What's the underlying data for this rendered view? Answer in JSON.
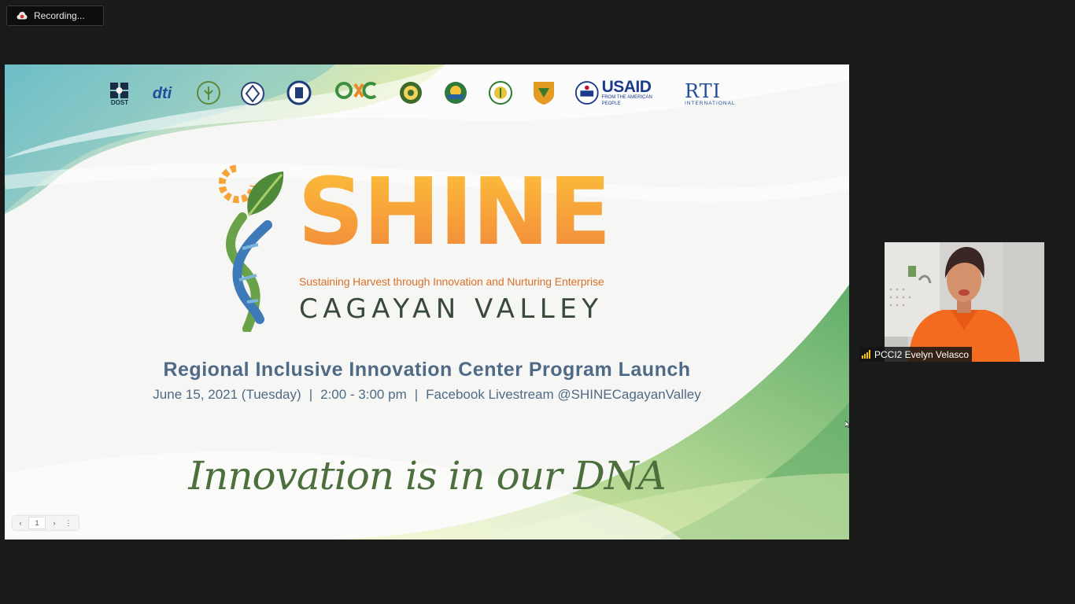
{
  "recording": {
    "label": "Recording..."
  },
  "slide": {
    "logos": [
      "DOST",
      "dti",
      "USAID",
      "FROM THE AMERICAN PEOPLE",
      "RTI",
      "INTERNATIONAL"
    ],
    "title": "SHINE",
    "tagline": "Sustaining Harvest through Innovation and Nurturing Enterprise",
    "region": "CAGAYAN VALLEY",
    "program_title": "Regional Inclusive Innovation Center Program Launch",
    "date": "June 15, 2021 (Tuesday)",
    "time": "2:00 - 3:00 pm",
    "venue": "Facebook Livestream @SHINECagayanValley",
    "separator": "|",
    "motto": "Innovation is in our DNA"
  },
  "pager": {
    "prev": "‹",
    "page": "1",
    "next": "›",
    "more": "⋮"
  },
  "participant": {
    "name": "PCCI2 Evelyn Velasco"
  },
  "colors": {
    "background": "#1a1a1a",
    "shine_orange": "#f7a13a",
    "program_blue": "#4f6a86",
    "motto_green": "#4d6f3e"
  }
}
